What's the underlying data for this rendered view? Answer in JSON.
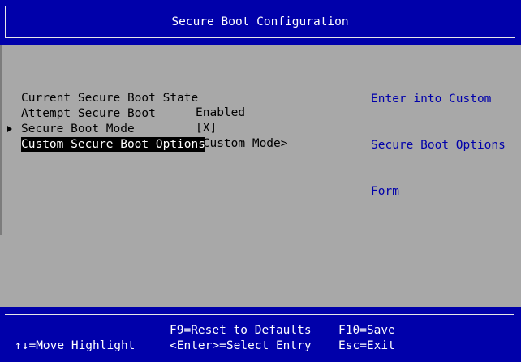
{
  "header": {
    "title": "Secure Boot Configuration"
  },
  "settings": [
    {
      "label": "Current Secure Boot State",
      "value": "Enabled"
    },
    {
      "label": "Attempt Secure Boot",
      "value": "[X]"
    },
    {
      "label": "Secure Boot Mode",
      "value": "<Custom Mode>"
    },
    {
      "label": "Custom Secure Boot Options",
      "value": ""
    }
  ],
  "help_text": [
    "Enter into Custom",
    "Secure Boot Options",
    "Form"
  ],
  "footer": {
    "move_highlight": "↑↓=Move Highlight",
    "reset_defaults": "F9=Reset to Defaults",
    "select_entry": "<Enter>=Select Entry",
    "save": "F10=Save",
    "exit": "Esc=Exit"
  },
  "colors": {
    "background": "#a8a8a8",
    "header_footer": "#0000aa",
    "help_text": "#0000aa",
    "highlight_bg": "#000000",
    "highlight_fg": "#ffffff"
  }
}
